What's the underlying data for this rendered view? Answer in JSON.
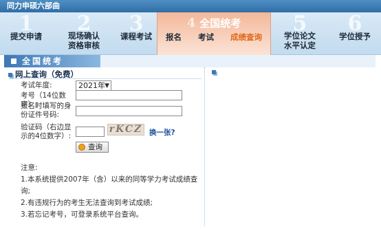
{
  "window": {
    "title": "同力申硕六部曲"
  },
  "steps": [
    {
      "num": "1",
      "label": "提交申请"
    },
    {
      "num": "2",
      "label": "现场确认\n资格审核"
    },
    {
      "num": "3",
      "label": "课程考试"
    },
    {
      "num": "4",
      "label": "全国统考",
      "active": true,
      "subitems": [
        "报名",
        "考试",
        "成绩查询"
      ]
    },
    {
      "num": "5",
      "label": "学位论文\n水平认定"
    },
    {
      "num": "6",
      "label": "学位授予"
    }
  ],
  "section": {
    "title": "全国统考"
  },
  "query": {
    "heading": "网上查询（免费）",
    "exam_year_label": "考试年度:",
    "exam_year_value": "2021年",
    "exam_no_label": "考号（14位数字）:",
    "id_label": "报名时填写的身份证件号码:",
    "captcha_label": "验证码（右边显示的4位数字）:",
    "captcha_text": "rKCZ",
    "refresh_label": "换一张?",
    "submit_label": "查询"
  },
  "notes": {
    "title": "注意:",
    "items": [
      "1.本系统提供2007年（含）以来的同等学力考试成绩查询;",
      "2.有违规行为的考生无法查询到考试成绩;",
      "3.若忘记考号，可登录系统平台查询。"
    ]
  },
  "colors": {
    "accent": "#3d78b5",
    "active_step": "#f3b89a",
    "current_sub": "#e06a1c",
    "link": "#1c4fa0"
  }
}
